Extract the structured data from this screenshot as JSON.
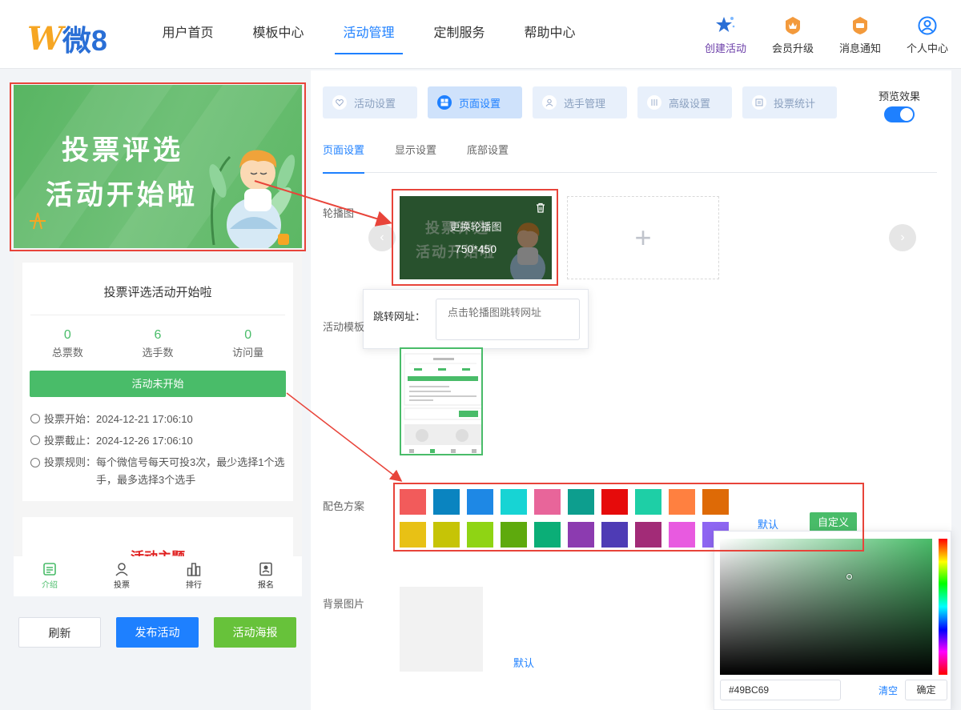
{
  "header": {
    "logo_mark": "W",
    "logo_text": "微8",
    "nav": [
      "用户首页",
      "模板中心",
      "活动管理",
      "定制服务",
      "帮助中心"
    ],
    "active_nav": 2,
    "tools": [
      {
        "label": "创建活动",
        "icon": "star-sparkle-icon",
        "color": "#6b3ea8"
      },
      {
        "label": "会员升级",
        "icon": "crown-badge-icon",
        "color": "#f39a3c"
      },
      {
        "label": "消息通知",
        "icon": "message-badge-icon",
        "color": "#f39a3c"
      },
      {
        "label": "个人中心",
        "icon": "user-circle-icon",
        "color": "#1e80ff"
      }
    ]
  },
  "preview": {
    "banner_line1": "投票评选",
    "banner_line2": "活动开始啦",
    "activity_title": "投票评选活动开始啦",
    "stats": [
      {
        "value": "0",
        "label": "总票数"
      },
      {
        "value": "6",
        "label": "选手数"
      },
      {
        "value": "0",
        "label": "访问量"
      }
    ],
    "status_button": "活动未开始",
    "vote_start_label": "投票开始：",
    "vote_start": "2024-12-21 17:06:10",
    "vote_end_label": "投票截止：",
    "vote_end": "2024-12-26 17:06:10",
    "rule_label": "投票规则：",
    "rule_line1": "每个微信号每天可投3次，最少选择1个选",
    "rule_line2": "手，最多选择3个选手",
    "section_title": "活动主题",
    "tabbar": [
      "介绍",
      "投票",
      "排行",
      "报名"
    ],
    "active_tab": 0
  },
  "actions": {
    "refresh": "刷新",
    "publish": "发布活动",
    "poster": "活动海报"
  },
  "editor": {
    "steps": [
      "活动设置",
      "页面设置",
      "选手管理",
      "高级设置",
      "投票统计"
    ],
    "active_step": 1,
    "preview_toggle_label": "预览效果",
    "preview_toggle_on": true,
    "subtabs": [
      "页面设置",
      "显示设置",
      "底部设置"
    ],
    "active_subtab": 0,
    "carousel_label": "轮播图",
    "carousel_change": "更换轮播图",
    "carousel_size": "750*450",
    "jump_label": "跳转网址：",
    "jump_placeholder": "点击轮播图跳转网址",
    "template_label": "活动模板",
    "palette_label": "配色方案",
    "palette_row1": [
      "#f25b5b",
      "#0a84c0",
      "#1e88e5",
      "#17d4d4",
      "#e8659a",
      "#0d9e8e",
      "#e60b0b",
      "#1ecfa6",
      "#ff8040",
      "#de6a06"
    ],
    "palette_row2": [
      "#e8c115",
      "#c6c406",
      "#8fd414",
      "#5eaa0d",
      "#0bae77",
      "#8c3bb0",
      "#4e3bb5",
      "#a22b77",
      "#e85ae0",
      "#8e66f2"
    ],
    "palette_default": "默认",
    "palette_custom": "自定义",
    "bg_label": "背景图片",
    "bg_default": "默认"
  },
  "color_picker": {
    "hex": "#49BC69",
    "clear": "清空",
    "confirm": "确定"
  }
}
